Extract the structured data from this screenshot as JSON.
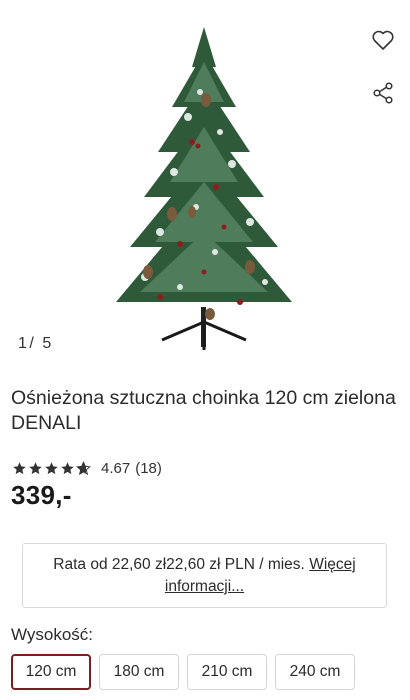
{
  "gallery": {
    "counter_current": "1",
    "counter_sep": "/",
    "counter_total": "5",
    "image_alt": "Ośnieżona sztuczna choinka 120 cm zielona DENALI"
  },
  "icons": {
    "wishlist": "heart-outline-icon",
    "share": "share-icon"
  },
  "product": {
    "title": "Ośnieżona sztuczna choinka 120 cm zielona DENALI",
    "rating_value": "4.67",
    "rating_count": "(18)",
    "rating_stars": 4.67,
    "price": "339,-"
  },
  "installment": {
    "text": "Rata od 22,60 zł22,60 zł PLN / mies.",
    "link": "Więcej informacji..."
  },
  "options": {
    "label": "Wysokość:",
    "sizes": [
      "120 cm",
      "180 cm",
      "210 cm",
      "240 cm"
    ],
    "selected": "120 cm"
  },
  "colors": {
    "accent": "#7a1e24",
    "text": "#2b2b2b",
    "border": "#d9d9d9",
    "tree_green": "#2f5a3a",
    "berry_red": "#8b1f1f"
  }
}
